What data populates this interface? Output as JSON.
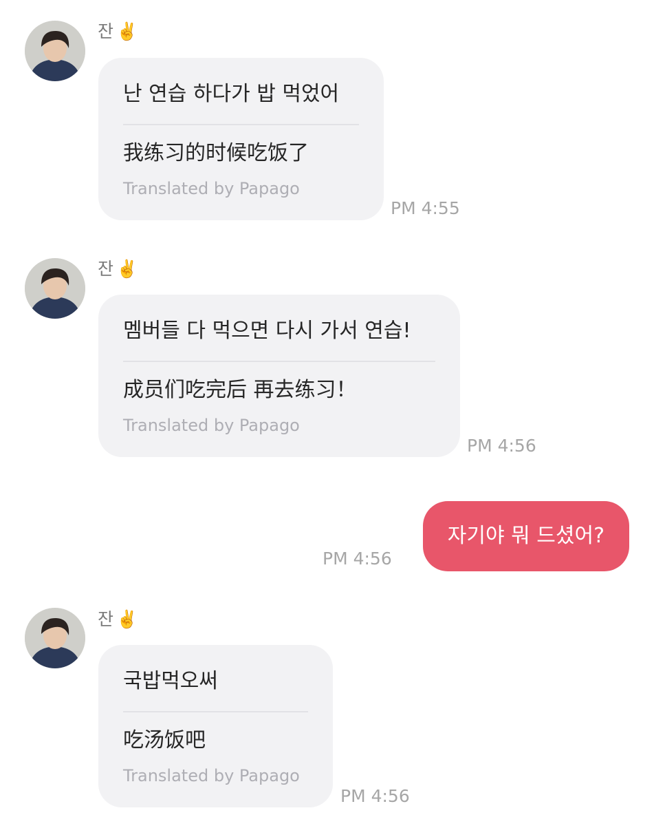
{
  "messages": [
    {
      "sender": "잔",
      "sender_emoji": "✌️",
      "original": "난 연습 하다가 밥 먹었어",
      "translation": "我练习的时候吃饭了",
      "translated_by": "Translated by Papago",
      "time": "PM 4:55"
    },
    {
      "sender": "잔",
      "sender_emoji": "✌️",
      "original": "멤버들 다 먹으면 다시 가서 연습!",
      "translation": "成员们吃完后 再去练习！",
      "translated_by": "Translated by Papago",
      "time": "PM 4:56"
    },
    {
      "outgoing": true,
      "text": "자기야 뭐 드셨어?",
      "time": "PM 4:56"
    },
    {
      "sender": "잔",
      "sender_emoji": "✌️",
      "original": "국밥먹오써",
      "translation": "吃汤饭吧",
      "translated_by": "Translated by Papago",
      "time": "PM 4:56"
    }
  ],
  "colors": {
    "incoming_bubble": "#f2f2f4",
    "outgoing_bubble": "#e8566a",
    "timestamp": "#a6a6a6"
  },
  "icons": {
    "avatar": "avatar-photo",
    "sender_emoji": "victory-hand-emoji"
  }
}
